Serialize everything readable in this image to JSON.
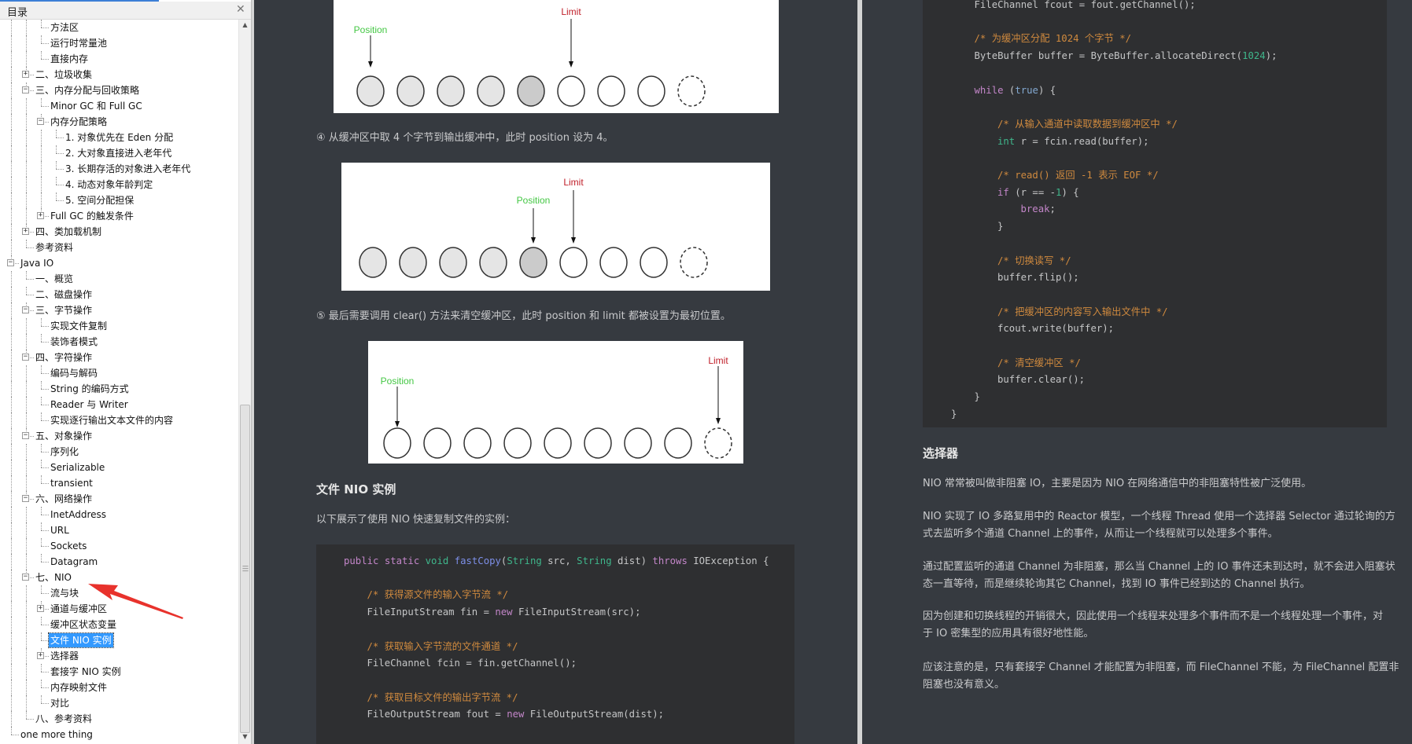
{
  "sidebar": {
    "title": "目录",
    "close_icon": "close-icon",
    "items": [
      {
        "level": 2,
        "label": "方法区"
      },
      {
        "level": 2,
        "label": "运行时常量池"
      },
      {
        "level": 2,
        "label": "直接内存"
      },
      {
        "level": 1,
        "label": "二、垃圾收集",
        "expander": "plus"
      },
      {
        "level": 1,
        "label": "三、内存分配与回收策略",
        "expander": "minus"
      },
      {
        "level": 2,
        "label": "Minor GC 和 Full GC"
      },
      {
        "level": 2,
        "label": "内存分配策略",
        "expander": "minus"
      },
      {
        "level": 3,
        "label": "1. 对象优先在 Eden 分配"
      },
      {
        "level": 3,
        "label": "2. 大对象直接进入老年代"
      },
      {
        "level": 3,
        "label": "3. 长期存活的对象进入老年代"
      },
      {
        "level": 3,
        "label": "4. 动态对象年龄判定"
      },
      {
        "level": 3,
        "label": "5. 空间分配担保"
      },
      {
        "level": 2,
        "label": "Full GC 的触发条件",
        "expander": "plus"
      },
      {
        "level": 1,
        "label": "四、类加载机制",
        "expander": "plus"
      },
      {
        "level": 1,
        "label": "参考资料"
      },
      {
        "level": 0,
        "label": "Java IO",
        "expander": "minus"
      },
      {
        "level": 1,
        "label": "一、概览"
      },
      {
        "level": 1,
        "label": "二、磁盘操作"
      },
      {
        "level": 1,
        "label": "三、字节操作",
        "expander": "minus"
      },
      {
        "level": 2,
        "label": "实现文件复制"
      },
      {
        "level": 2,
        "label": "装饰者模式"
      },
      {
        "level": 1,
        "label": "四、字符操作",
        "expander": "minus"
      },
      {
        "level": 2,
        "label": "编码与解码"
      },
      {
        "level": 2,
        "label": "String 的编码方式"
      },
      {
        "level": 2,
        "label": "Reader 与 Writer"
      },
      {
        "level": 2,
        "label": "实现逐行输出文本文件的内容"
      },
      {
        "level": 1,
        "label": "五、对象操作",
        "expander": "minus"
      },
      {
        "level": 2,
        "label": "序列化"
      },
      {
        "level": 2,
        "label": "Serializable"
      },
      {
        "level": 2,
        "label": "transient"
      },
      {
        "level": 1,
        "label": "六、网络操作",
        "expander": "minus"
      },
      {
        "level": 2,
        "label": "InetAddress"
      },
      {
        "level": 2,
        "label": "URL"
      },
      {
        "level": 2,
        "label": "Sockets"
      },
      {
        "level": 2,
        "label": "Datagram"
      },
      {
        "level": 1,
        "label": "七、NIO",
        "expander": "minus"
      },
      {
        "level": 2,
        "label": "流与块"
      },
      {
        "level": 2,
        "label": "通道与缓冲区",
        "expander": "plus"
      },
      {
        "level": 2,
        "label": "缓冲区状态变量"
      },
      {
        "level": 2,
        "label": "文件 NIO 实例",
        "selected": true
      },
      {
        "level": 2,
        "label": "选择器",
        "expander": "plus"
      },
      {
        "level": 2,
        "label": "套接字 NIO 实例"
      },
      {
        "level": 2,
        "label": "内存映射文件"
      },
      {
        "level": 2,
        "label": "对比"
      },
      {
        "level": 1,
        "label": "八、参考资料"
      },
      {
        "level": 0,
        "label": "one more thing"
      }
    ],
    "annotation_color": "#e8322c"
  },
  "left_page": {
    "diagrams": [
      {
        "cells": [
          "filled",
          "filled",
          "filled",
          "filled",
          "current",
          "empty",
          "empty",
          "empty",
          "capacity"
        ],
        "position_label": "Position",
        "limit_label": "Limit",
        "position_index": 0,
        "limit_index": 5
      },
      {
        "cells": [
          "filled",
          "filled",
          "filled",
          "filled",
          "current",
          "empty",
          "empty",
          "empty",
          "capacity"
        ],
        "position_label": "Position",
        "limit_label": "Limit",
        "position_index": 4,
        "limit_index": 5
      },
      {
        "cells": [
          "empty",
          "empty",
          "empty",
          "empty",
          "empty",
          "empty",
          "empty",
          "empty",
          "capacity"
        ],
        "position_label": "Position",
        "limit_label": "Limit",
        "position_index": 0,
        "limit_index": 8
      }
    ],
    "caption4": "④ 从缓冲区中取 4 个字节到输出缓冲中，此时 position 设为 4。",
    "caption5": "⑤ 最后需要调用 clear() 方法来清空缓冲区，此时 position 和 limit 都被设置为最初位置。",
    "heading": "文件 NIO 实例",
    "intro": "以下展示了使用 NIO 快速复制文件的实例：",
    "code": [
      {
        "indent": 0,
        "tokens": [
          [
            "public static ",
            "k"
          ],
          [
            "void ",
            "t"
          ],
          [
            "fastCopy",
            "f"
          ],
          [
            "(",
            ""
          ],
          [
            "String",
            "t"
          ],
          [
            " src, ",
            ""
          ],
          [
            "String",
            "t"
          ],
          [
            " dist) ",
            ""
          ],
          [
            "throws",
            "k"
          ],
          [
            " IOException {",
            ""
          ]
        ]
      },
      {
        "indent": 0,
        "tokens": []
      },
      {
        "indent": 1,
        "tokens": [
          [
            "/* 获得源文件的输入字节流 */",
            "c"
          ]
        ]
      },
      {
        "indent": 1,
        "tokens": [
          [
            "FileInputStream fin = ",
            ""
          ],
          [
            "new",
            "k"
          ],
          [
            " FileInputStream(src);",
            ""
          ]
        ]
      },
      {
        "indent": 0,
        "tokens": []
      },
      {
        "indent": 1,
        "tokens": [
          [
            "/* 获取输入字节流的文件通道 */",
            "c"
          ]
        ]
      },
      {
        "indent": 1,
        "tokens": [
          [
            "FileChannel fcin = fin.getChannel();",
            ""
          ]
        ]
      },
      {
        "indent": 0,
        "tokens": []
      },
      {
        "indent": 1,
        "tokens": [
          [
            "/* 获取目标文件的输出字节流 */",
            "c"
          ]
        ]
      },
      {
        "indent": 1,
        "tokens": [
          [
            "FileOutputStream fout = ",
            ""
          ],
          [
            "new",
            "k"
          ],
          [
            " FileOutputStream(dist);",
            ""
          ]
        ]
      }
    ]
  },
  "right_page": {
    "code": [
      {
        "indent": 1,
        "tokens": [
          [
            "FileChannel fcout = fout.getChannel();",
            ""
          ]
        ]
      },
      {
        "indent": 0,
        "tokens": []
      },
      {
        "indent": 1,
        "tokens": [
          [
            "/* 为缓冲区分配 1024 个字节 */",
            "c"
          ]
        ]
      },
      {
        "indent": 1,
        "tokens": [
          [
            "ByteBuffer buffer = ByteBuffer.allocateDirect(",
            ""
          ],
          [
            "1024",
            "n"
          ],
          [
            ");",
            ""
          ]
        ]
      },
      {
        "indent": 0,
        "tokens": []
      },
      {
        "indent": 1,
        "tokens": [
          [
            "while",
            "k"
          ],
          [
            " (",
            ""
          ],
          [
            "true",
            "b"
          ],
          [
            ") {",
            ""
          ]
        ]
      },
      {
        "indent": 0,
        "tokens": []
      },
      {
        "indent": 2,
        "tokens": [
          [
            "/* 从输入通道中读取数据到缓冲区中 */",
            "c"
          ]
        ]
      },
      {
        "indent": 2,
        "tokens": [
          [
            "int",
            "t"
          ],
          [
            " r = fcin.read(buffer);",
            ""
          ]
        ]
      },
      {
        "indent": 0,
        "tokens": []
      },
      {
        "indent": 2,
        "tokens": [
          [
            "/* read() 返回 -1 表示 EOF */",
            "c"
          ]
        ]
      },
      {
        "indent": 2,
        "tokens": [
          [
            "if",
            "k"
          ],
          [
            " (r == -",
            ""
          ],
          [
            "1",
            "n"
          ],
          [
            ") {",
            ""
          ]
        ]
      },
      {
        "indent": 3,
        "tokens": [
          [
            "break",
            "k"
          ],
          [
            ";",
            ""
          ]
        ]
      },
      {
        "indent": 2,
        "tokens": [
          [
            "}",
            ""
          ]
        ]
      },
      {
        "indent": 0,
        "tokens": []
      },
      {
        "indent": 2,
        "tokens": [
          [
            "/* 切换读写 */",
            "c"
          ]
        ]
      },
      {
        "indent": 2,
        "tokens": [
          [
            "buffer.flip();",
            ""
          ]
        ]
      },
      {
        "indent": 0,
        "tokens": []
      },
      {
        "indent": 2,
        "tokens": [
          [
            "/* 把缓冲区的内容写入输出文件中 */",
            "c"
          ]
        ]
      },
      {
        "indent": 2,
        "tokens": [
          [
            "fcout.write(buffer);",
            ""
          ]
        ]
      },
      {
        "indent": 0,
        "tokens": []
      },
      {
        "indent": 2,
        "tokens": [
          [
            "/* 清空缓冲区 */",
            "c"
          ]
        ]
      },
      {
        "indent": 2,
        "tokens": [
          [
            "buffer.clear();",
            ""
          ]
        ]
      },
      {
        "indent": 1,
        "tokens": [
          [
            "}",
            ""
          ]
        ]
      },
      {
        "indent": 0,
        "tokens": [
          [
            "}",
            ""
          ]
        ]
      }
    ],
    "heading": "选择器",
    "paragraphs": [
      [
        "NIO 常常被叫做非阻塞 IO，主要是因为 NIO 在网络通信中的非阻塞特性被广泛使用。"
      ],
      [
        "NIO 实现了 IO 多路复用中的 Reactor 模型，一个线程 Thread 使用一个选择器 Selector 通过轮询的方",
        "式去监听多个通道 Channel 上的事件，从而让一个线程就可以处理多个事件。"
      ],
      [
        "通过配置监听的通道 Channel 为非阻塞，那么当 Channel 上的 IO 事件还未到达时，就不会进入阻塞状",
        "态一直等待，而是继续轮询其它 Channel，找到 IO 事件已经到达的 Channel 执行。"
      ],
      [
        "因为创建和切换线程的开销很大，因此使用一个线程来处理多个事件而不是一个线程处理一个事件，对",
        "于 IO 密集型的应用具有很好地性能。"
      ],
      [
        "应该注意的是，只有套接字 Channel 才能配置为非阻塞，而 FileChannel 不能，为 FileChannel 配置非",
        "阻塞也没有意义。"
      ]
    ]
  },
  "colors": {
    "page_bg": "#363a40",
    "code_bg": "#2e2f31",
    "position": "#44c744",
    "limit": "#c0202a",
    "selection": "#3399ff"
  }
}
